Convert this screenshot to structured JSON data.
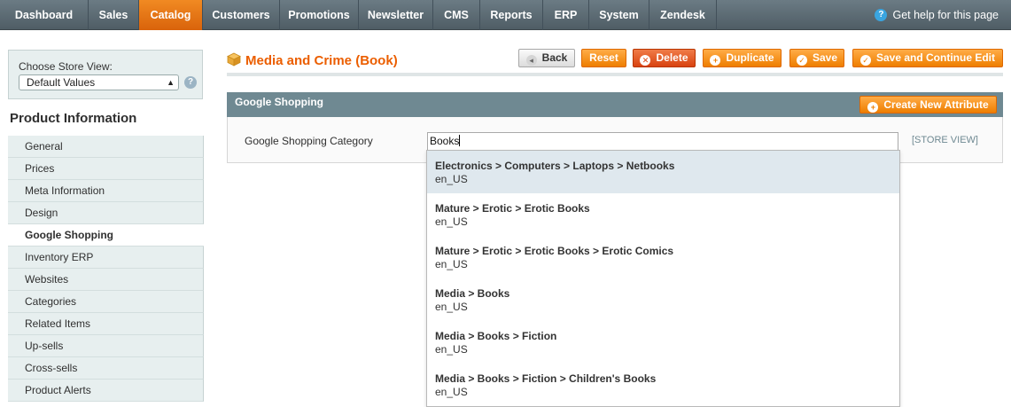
{
  "nav": {
    "items": [
      "Dashboard",
      "Sales",
      "Catalog",
      "Customers",
      "Promotions",
      "Newsletter",
      "CMS",
      "Reports",
      "ERP",
      "System",
      "Zendesk"
    ],
    "active": "Catalog",
    "help": "Get help for this page"
  },
  "sidebar": {
    "store_label": "Choose Store View:",
    "store_value": "Default Values",
    "section_title": "Product Information",
    "items": [
      "General",
      "Prices",
      "Meta Information",
      "Design",
      "Google Shopping",
      "Inventory ERP",
      "Websites",
      "Categories",
      "Related Items",
      "Up-sells",
      "Cross-sells",
      "Product Alerts"
    ],
    "active": "Google Shopping"
  },
  "header": {
    "title": "Media and Crime (Book)",
    "buttons": {
      "back": "Back",
      "reset": "Reset",
      "delete": "Delete",
      "duplicate": "Duplicate",
      "save": "Save",
      "save_continue": "Save and Continue Edit"
    }
  },
  "section": {
    "title": "Google Shopping",
    "create_button": "Create New Attribute",
    "field_label": "Google Shopping Category",
    "field_value": "Books",
    "scope": "[STORE VIEW]"
  },
  "suggestions": [
    {
      "path": "Electronics > Computers > Laptops > Netbooks",
      "locale": "en_US"
    },
    {
      "path": "Mature > Erotic > Erotic Books",
      "locale": "en_US"
    },
    {
      "path": "Mature > Erotic > Erotic Books > Erotic Comics",
      "locale": "en_US"
    },
    {
      "path": "Media > Books",
      "locale": "en_US"
    },
    {
      "path": "Media > Books > Fiction",
      "locale": "en_US"
    },
    {
      "path": "Media > Books > Fiction > Children's Books",
      "locale": "en_US"
    }
  ],
  "colors": {
    "accent": "#eb5e00",
    "nav_active": "#e8750f",
    "section_head": "#6f8992"
  }
}
